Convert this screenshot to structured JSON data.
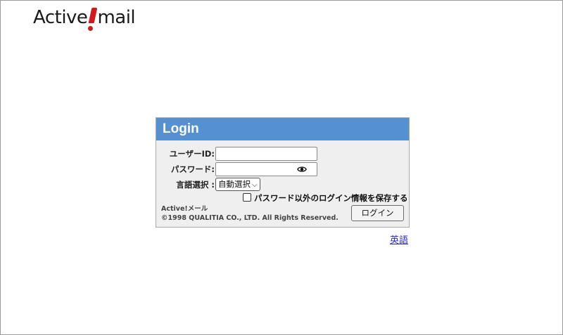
{
  "logo": {
    "part1": "Active",
    "part2": "mail"
  },
  "login": {
    "title": "Login",
    "user_id_label": "ユーザーID:",
    "user_id_value": "",
    "password_label": "パスワード:",
    "password_value": "",
    "language_label": "言語選択 :",
    "language_selected": "自動選択",
    "save_info_label": "パスワード以外のログイン情報を保存する",
    "login_button": "ログイン",
    "footer_app": "Active!メール",
    "footer_copyright": "©1998 QUALITIA CO., LTD. All Rights Reserved."
  },
  "language_link": "英語",
  "colors": {
    "header": "#5590d2",
    "logo_accent": "#d4161d",
    "link": "#2b2bd6"
  }
}
